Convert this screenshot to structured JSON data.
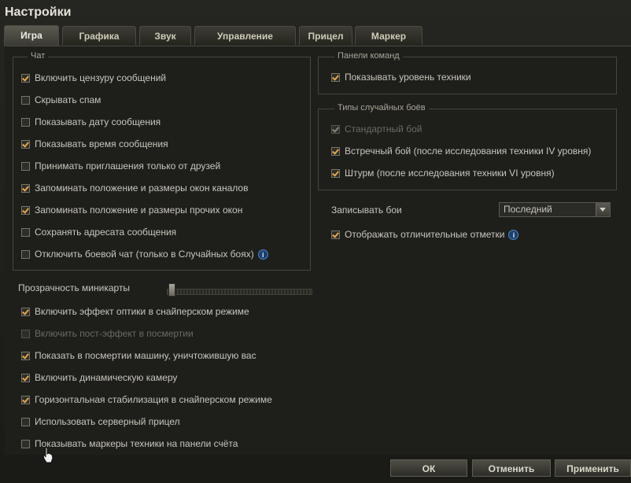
{
  "window": {
    "title": "Настройки"
  },
  "tabs": [
    {
      "label": "Игра"
    },
    {
      "label": "Графика"
    },
    {
      "label": "Звук"
    },
    {
      "label": "Управление"
    },
    {
      "label": "Прицел"
    },
    {
      "label": "Маркер"
    }
  ],
  "chat": {
    "legend": "Чат",
    "options": [
      {
        "label": "Включить цензуру сообщений",
        "checked": true
      },
      {
        "label": "Скрывать спам",
        "checked": false
      },
      {
        "label": "Показывать дату сообщения",
        "checked": false
      },
      {
        "label": "Показывать время сообщения",
        "checked": true
      },
      {
        "label": "Принимать приглашения только от друзей",
        "checked": false
      },
      {
        "label": "Запоминать положение и размеры окон каналов",
        "checked": true
      },
      {
        "label": "Запоминать положение и размеры прочих окон",
        "checked": true
      },
      {
        "label": "Сохранять адресата сообщения",
        "checked": false
      },
      {
        "label": "Отключить боевой чат (только в Случайных боях)",
        "checked": false,
        "info": "i"
      }
    ]
  },
  "minimap": {
    "label": "Прозрачность миникарты",
    "value": 0
  },
  "general": {
    "options": [
      {
        "label": "Включить эффект оптики в снайперском режиме",
        "checked": true
      },
      {
        "label": "Включить пост-эффект в посмертии",
        "checked": false,
        "disabled": true
      },
      {
        "label": "Показать в посмертии машину, уничтожившую вас",
        "checked": true
      },
      {
        "label": "Включить динамическую камеру",
        "checked": true
      },
      {
        "label": "Горизонтальная стабилизация в снайперском режиме",
        "checked": true
      },
      {
        "label": "Использовать серверный прицел",
        "checked": false
      },
      {
        "label": "Показывать маркеры техники на панели счёта",
        "checked": false
      }
    ]
  },
  "team_panels": {
    "legend": "Панели команд",
    "options": [
      {
        "label": "Показывать уровень техники",
        "checked": true
      }
    ]
  },
  "battle_types": {
    "legend": "Типы случайных боёв",
    "options": [
      {
        "label": "Стандартный бой",
        "checked": true,
        "disabled": true
      },
      {
        "label": "Встречный бой (после исследования техники IV уровня)",
        "checked": true
      },
      {
        "label": "Штурм (после исследования техники VI уровня)",
        "checked": true
      }
    ]
  },
  "replays": {
    "label": "Записывать бои",
    "selected": "Последний"
  },
  "marks": {
    "label": "Отображать отличительные отметки",
    "checked": true,
    "info": "i"
  },
  "footer": {
    "ok": "ОК",
    "cancel": "Отменить",
    "apply": "Применить"
  },
  "colors": {
    "accent": "#e6a64a",
    "background": "#1e1e1b",
    "info": "#1c3f6e"
  }
}
